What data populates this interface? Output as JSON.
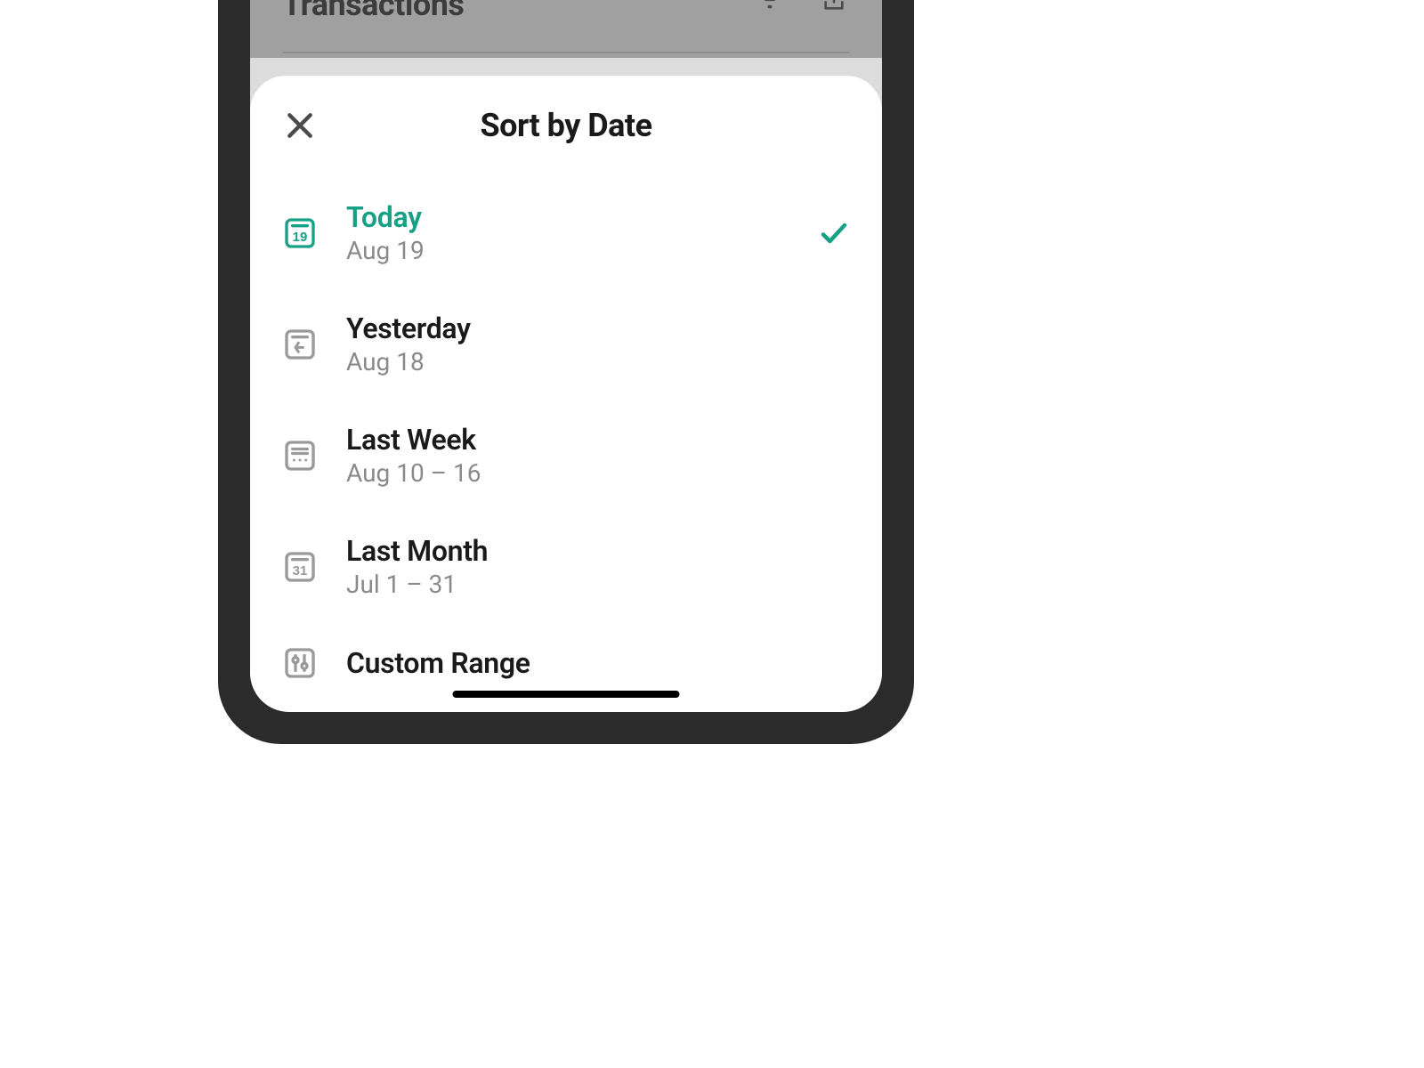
{
  "background": {
    "title": "Transactions"
  },
  "sheet": {
    "title": "Sort by Date",
    "options": [
      {
        "label": "Today",
        "sublabel": "Aug 19",
        "selected": true
      },
      {
        "label": "Yesterday",
        "sublabel": "Aug 18",
        "selected": false
      },
      {
        "label": "Last Week",
        "sublabel": "Aug 10 – 16",
        "selected": false
      },
      {
        "label": "Last Month",
        "sublabel": "Jul 1 – 31",
        "selected": false
      },
      {
        "label": "Custom Range",
        "sublabel": "",
        "selected": false
      }
    ]
  },
  "colors": {
    "accent": "#16a085",
    "iconGray": "#9a9a9a",
    "textDark": "#1a1a1a",
    "textMuted": "#8a8a8a"
  }
}
